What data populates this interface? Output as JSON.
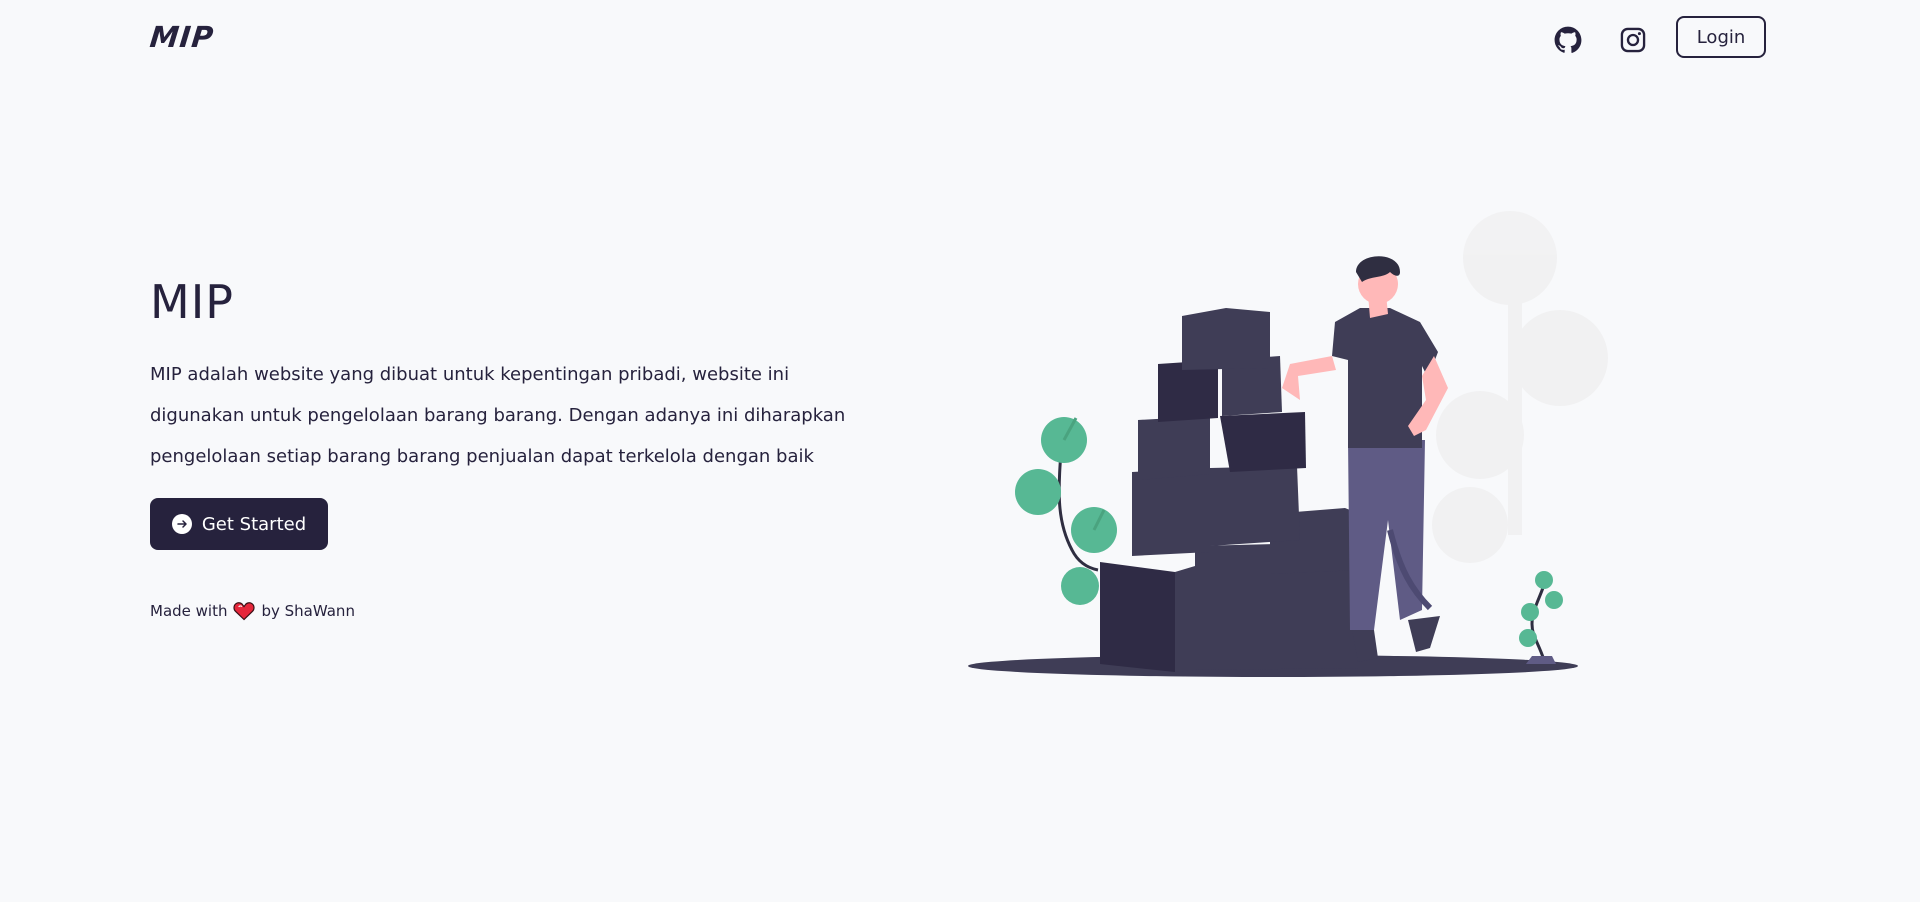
{
  "header": {
    "logo_text": "MIP",
    "github_icon": "github-icon",
    "instagram_icon": "instagram-icon",
    "login_label": "Login"
  },
  "hero": {
    "title": "MIP",
    "description": "MIP adalah website yang dibuat untuk kepentingan pribadi, website ini digunakan untuk pengelolaan barang barang. Dengan adanya ini diharapkan pengelolaan setiap barang barang penjualan dapat terkelola dengan baik",
    "cta_label": "Get Started",
    "cta_icon": "arrow-right-circle-icon",
    "credit_prefix": "Made with",
    "credit_icon": "heart-icon",
    "credit_suffix": "by ShaWann"
  },
  "colors": {
    "background": "#f8f9fb",
    "primary": "#26223d",
    "box_dark": "#2f2b45",
    "box_mid": "#3f3d56",
    "plant_green": "#57b894",
    "skin": "#ffb8b8",
    "pants": "#5f5b85"
  }
}
